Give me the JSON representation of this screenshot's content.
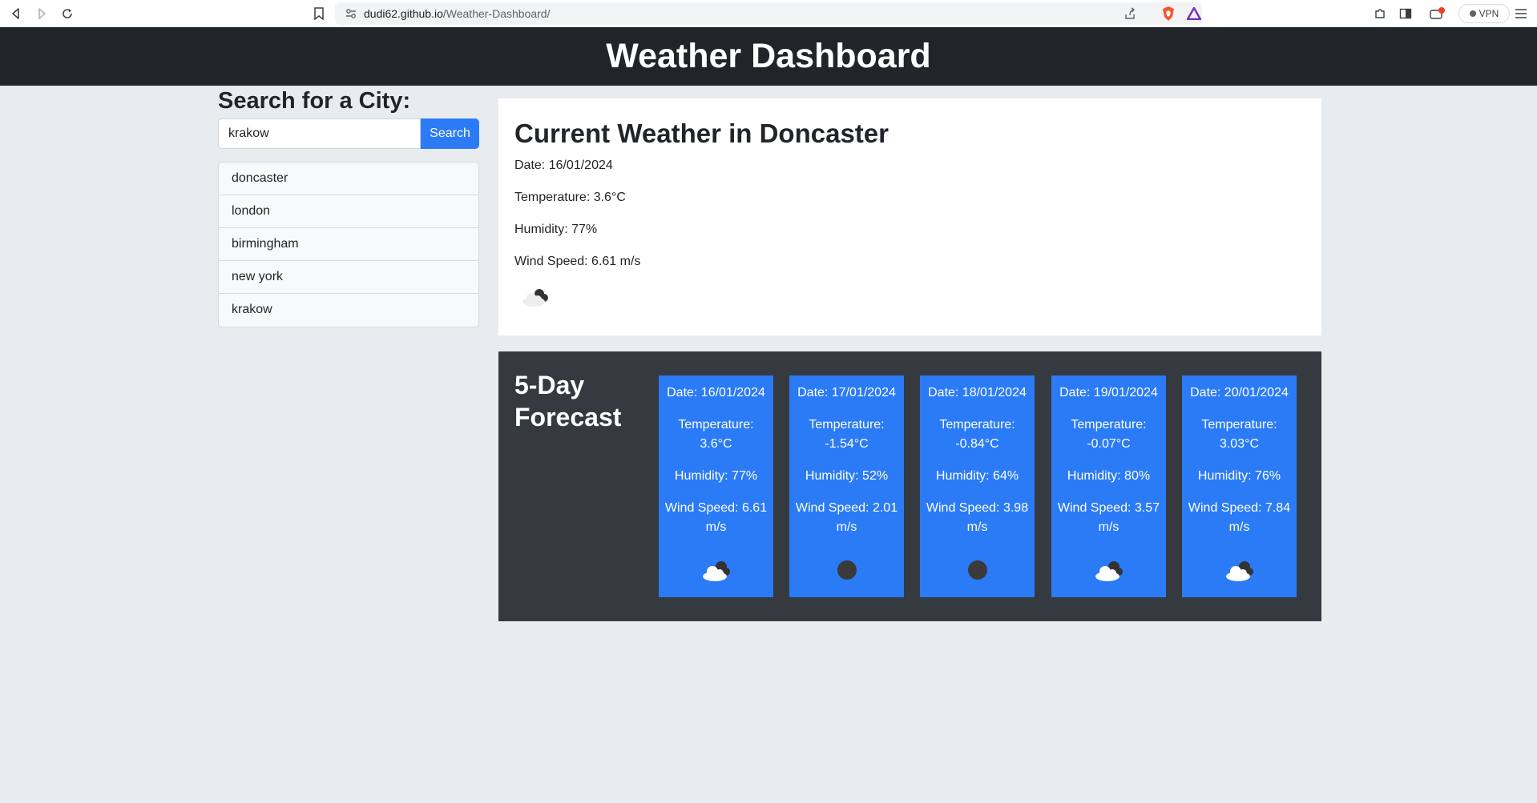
{
  "browser": {
    "url_host": "dudi62.github.io",
    "url_path": "/Weather-Dashboard/",
    "vpn_label": "VPN"
  },
  "header": {
    "title": "Weather Dashboard"
  },
  "sidebar": {
    "heading": "Search for a City:",
    "search_value": "krakow",
    "search_button": "Search",
    "history": [
      "doncaster",
      "london",
      "birmingham",
      "new york",
      "krakow"
    ]
  },
  "current": {
    "title": "Current Weather in Doncaster",
    "date": "Date: 16/01/2024",
    "temperature": "Temperature: 3.6°C",
    "humidity": "Humidity: 77%",
    "wind": "Wind Speed: 6.61 m/s",
    "icon": "broken-clouds-icon"
  },
  "forecast": {
    "heading": "5-Day Forecast",
    "days": [
      {
        "date": "Date: 16/01/2024",
        "temperature": "Temperature: 3.6°C",
        "humidity": "Humidity: 77%",
        "wind": "Wind Speed: 6.61 m/s",
        "icon": "broken-clouds-icon"
      },
      {
        "date": "Date: 17/01/2024",
        "temperature": "Temperature: -1.54°C",
        "humidity": "Humidity: 52%",
        "wind": "Wind Speed: 2.01 m/s",
        "icon": "clear-night-icon"
      },
      {
        "date": "Date: 18/01/2024",
        "temperature": "Temperature: -0.84°C",
        "humidity": "Humidity: 64%",
        "wind": "Wind Speed: 3.98 m/s",
        "icon": "clear-night-icon"
      },
      {
        "date": "Date: 19/01/2024",
        "temperature": "Temperature: -0.07°C",
        "humidity": "Humidity: 80%",
        "wind": "Wind Speed: 3.57 m/s",
        "icon": "broken-clouds-icon"
      },
      {
        "date": "Date: 20/01/2024",
        "temperature": "Temperature: 3.03°C",
        "humidity": "Humidity: 76%",
        "wind": "Wind Speed: 7.84 m/s",
        "icon": "broken-clouds-icon"
      }
    ]
  },
  "colors": {
    "accent": "#2b7bf7",
    "header_bg": "#212529",
    "forecast_bg": "#343a40",
    "page_bg": "#e9ecef"
  }
}
